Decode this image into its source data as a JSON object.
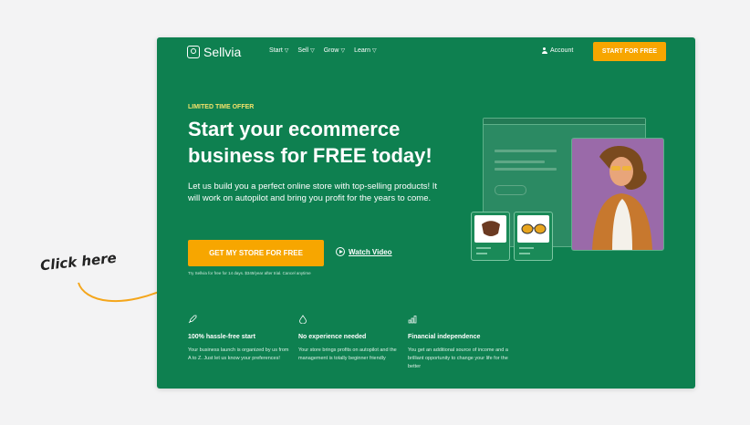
{
  "annotation": {
    "label": "Click here"
  },
  "nav": {
    "logo_text": "Sellvia",
    "menu": [
      {
        "label": "Start"
      },
      {
        "label": "Sell"
      },
      {
        "label": "Grow"
      },
      {
        "label": "Learn"
      }
    ],
    "account_label": "Account",
    "cta_label": "START FOR FREE"
  },
  "hero": {
    "offer_label": "LIMITED TIME OFFER",
    "headline": "Start your ecommerce business for FREE today!",
    "description": "Let us build you a perfect online store with top-selling products! It will work on autopilot and bring you profit for the years to come.",
    "cta_label": "GET MY STORE FOR FREE",
    "watch_label": "Watch Video",
    "trial_note": "Try Sellvia for free for 14 days. $349/year after trial. Cancel anytime"
  },
  "features": [
    {
      "title": "100% hassle-free start",
      "text": "Your business launch is organized by us from A to Z. Just let us know your preferences!",
      "icon": "rocket-icon"
    },
    {
      "title": "No experience needed",
      "text": "Your store brings profits on autopilot and the management is totally beginner friendly",
      "icon": "drop-icon"
    },
    {
      "title": "Financial independence",
      "text": "You get an additional source of income and a brilliant opportunity to change your life for the better",
      "icon": "bar-chart-icon"
    }
  ],
  "colors": {
    "brand_green": "#0e8050",
    "accent_orange": "#f7a600",
    "offer_yellow": "#f3e26a"
  }
}
